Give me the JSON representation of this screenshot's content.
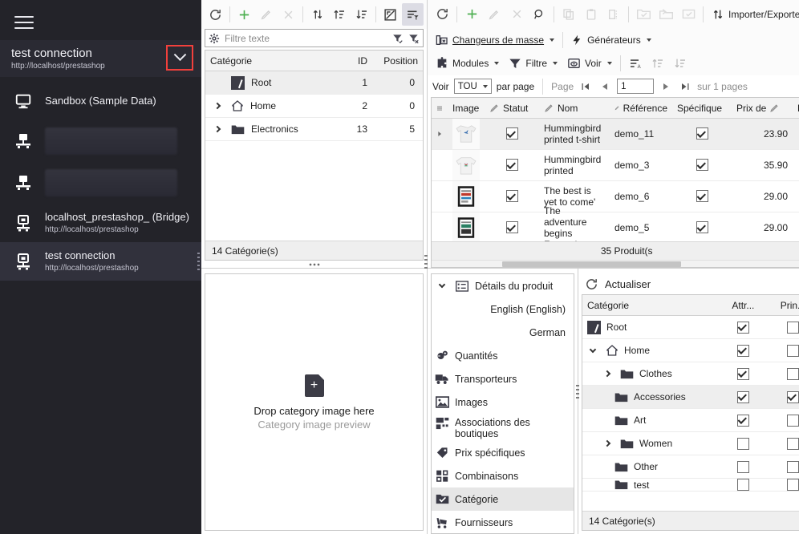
{
  "sidebar": {
    "menu_icon": "hamburger-icon",
    "connection": {
      "title": "test connection",
      "url": "http://localhost/prestashop",
      "dropdown_icon": "chevron-down-icon"
    },
    "items": [
      {
        "label": "Sandbox (Sample Data)",
        "url": "",
        "icon": "monitor-icon",
        "redacted": false,
        "selected": false
      },
      {
        "label": "",
        "url": "",
        "icon": "server-icon",
        "redacted": true,
        "selected": false
      },
      {
        "label": "",
        "url": "",
        "icon": "server-icon",
        "redacted": true,
        "selected": false
      },
      {
        "label": "localhost_prestashop_ (Bridge)",
        "url": "http://localhost/prestashop",
        "icon": "database-icon",
        "redacted": false,
        "selected": false
      },
      {
        "label": "test connection",
        "url": "http://localhost/prestashop",
        "icon": "database-icon",
        "redacted": false,
        "selected": true
      }
    ]
  },
  "category_panel": {
    "toolbar_icons": [
      "refresh-icon",
      "add-icon",
      "edit-icon",
      "delete-icon",
      "move-updown-icon",
      "sort-asc-icon",
      "sort-desc-icon",
      "export-image-icon",
      "filter-rows-icon"
    ],
    "filter": {
      "gear_icon": "gear-icon",
      "placeholder": "Filtre texte",
      "apply_icon": "filter-apply-icon",
      "clear_icon": "filter-clear-icon"
    },
    "columns": [
      "Catégorie",
      "ID",
      "Position"
    ],
    "rows": [
      {
        "label": "Root",
        "id": "1",
        "position": "0",
        "indent": 0,
        "icon": "root-badge-icon",
        "expander": "none",
        "selected": true
      },
      {
        "label": "Home",
        "id": "2",
        "position": "0",
        "indent": 0,
        "icon": "home-icon",
        "expander": "right",
        "selected": false
      },
      {
        "label": "Electronics",
        "id": "13",
        "position": "5",
        "indent": 0,
        "icon": "folder-icon",
        "expander": "right",
        "selected": false
      }
    ],
    "footer": "14 Catégorie(s)"
  },
  "product_panel": {
    "toolbar_icons": [
      "refresh-icon",
      "add-icon",
      "edit-icon",
      "delete-icon",
      "search-icon",
      "copy-icon",
      "paste-icon",
      "duplicate-icon",
      "check-folder-icon",
      "transfer-icon",
      "approve-icon",
      "import-export-icon"
    ],
    "import_export_label": "Importer/Exporter",
    "mass_changers_label": "Changeurs de masse",
    "generators_label": "Générateurs",
    "modules_label": "Modules",
    "filter_label": "Filtre",
    "view_label": "Voir",
    "paging": {
      "show_label": "Voir",
      "per_page_value": "TOU",
      "per_page_label": "par page",
      "page_label": "Page",
      "page_value": "1",
      "total_label": "sur 1 pages"
    },
    "columns": [
      "Image",
      "Statut",
      "Nom",
      "Référence",
      "Spécifique",
      "Prix de",
      "P"
    ],
    "rows": [
      {
        "image": "tshirt-hummingbird-thumb",
        "status": true,
        "name": "Hummingbird printed t-shirt",
        "reference": "demo_11",
        "specific": true,
        "price": "23.90",
        "selected": true
      },
      {
        "image": "sweater-hummingbird-thumb",
        "status": true,
        "name": "Hummingbird printed",
        "reference": "demo_3",
        "specific": true,
        "price": "35.90",
        "selected": false
      },
      {
        "image": "poster-best-thumb",
        "status": true,
        "name": "The best is yet to come'",
        "reference": "demo_6",
        "specific": true,
        "price": "29.00",
        "selected": false
      },
      {
        "image": "poster-adventure-thumb",
        "status": true,
        "name": "The adventure begins Framed",
        "reference": "demo_5",
        "specific": true,
        "price": "29.00",
        "selected": false
      }
    ],
    "footer": "35 Produit(s"
  },
  "image_drop_panel": {
    "icon": "add-file-icon",
    "title": "Drop category image here",
    "subtitle": "Category image preview"
  },
  "details_panel": {
    "header": {
      "label": "Détails du produit",
      "icon": "details-icon",
      "expander": "down"
    },
    "items": [
      {
        "label": "English (English)",
        "icon": "",
        "sub": true,
        "selected": false
      },
      {
        "label": "German",
        "icon": "",
        "sub": true,
        "selected": false
      },
      {
        "label": "Quantités",
        "icon": "quantities-icon",
        "sub": false,
        "selected": false
      },
      {
        "label": "Transporteurs",
        "icon": "truck-icon",
        "sub": false,
        "selected": false
      },
      {
        "label": "Images",
        "icon": "image-icon",
        "sub": false,
        "selected": false
      },
      {
        "label": "Associations des boutiques",
        "icon": "shops-icon",
        "sub": false,
        "selected": false
      },
      {
        "label": "Prix spécifiques",
        "icon": "tag-icon",
        "sub": false,
        "selected": false
      },
      {
        "label": "Combinaisons",
        "icon": "combinations-icon",
        "sub": false,
        "selected": false
      },
      {
        "label": "Catégorie",
        "icon": "category-check-icon",
        "sub": false,
        "selected": true
      },
      {
        "label": "Fournisseurs",
        "icon": "suppliers-icon",
        "sub": false,
        "selected": false
      }
    ]
  },
  "assoc_panel": {
    "refresh_label": "Actualiser",
    "refresh_icon": "refresh-icon",
    "dropdown_icon": "caret-down-icon",
    "columns": [
      "Catégorie",
      "Attr...",
      "Prin..."
    ],
    "rows": [
      {
        "label": "Root",
        "indent": 0,
        "icon": "root-badge-icon",
        "expander": "none",
        "attr": true,
        "main": false,
        "selected": false
      },
      {
        "label": "Home",
        "indent": 0,
        "icon": "home-icon",
        "expander": "down",
        "attr": true,
        "main": false,
        "selected": false
      },
      {
        "label": "Clothes",
        "indent": 1,
        "icon": "folder-icon",
        "expander": "right",
        "attr": true,
        "main": false,
        "selected": false
      },
      {
        "label": "Accessories",
        "indent": 1,
        "icon": "folder-icon",
        "expander": "none",
        "attr": true,
        "main": true,
        "selected": true
      },
      {
        "label": "Art",
        "indent": 1,
        "icon": "folder-icon",
        "expander": "none",
        "attr": true,
        "main": false,
        "selected": false
      },
      {
        "label": "Women",
        "indent": 1,
        "icon": "folder-icon",
        "expander": "right",
        "attr": false,
        "main": false,
        "selected": false
      },
      {
        "label": "Other",
        "indent": 1,
        "icon": "folder-icon",
        "expander": "none",
        "attr": false,
        "main": false,
        "selected": false
      },
      {
        "label": "test",
        "indent": 1,
        "icon": "folder-icon",
        "expander": "none",
        "attr": false,
        "main": false,
        "selected": false
      }
    ],
    "footer": "14 Catégorie(s)"
  },
  "colors": {
    "sidebar_bg": "#232329",
    "sidebar_selected": "#31313c",
    "highlight_box": "#f2403c",
    "add_green": "#4caf50",
    "header_bg": "#f3f3f3"
  }
}
